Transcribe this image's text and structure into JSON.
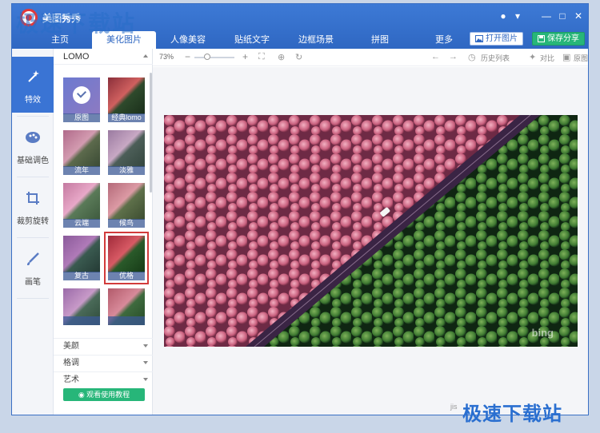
{
  "app": {
    "title": "美图秀秀"
  },
  "window_controls": {
    "chat": "●",
    "menu": "▾",
    "minimize": "—",
    "maximize": "□",
    "close": "✕"
  },
  "tabs": [
    {
      "label": "主页"
    },
    {
      "label": "美化图片"
    },
    {
      "label": "人像美容"
    },
    {
      "label": "贴纸文字"
    },
    {
      "label": "边框场景"
    },
    {
      "label": "拼图"
    },
    {
      "label": "更多"
    }
  ],
  "header_buttons": {
    "open": "打开图片",
    "save": "保存分享"
  },
  "rail": [
    {
      "label": "特效",
      "icon": "magic-wand-icon"
    },
    {
      "label": "基础调色",
      "icon": "palette-icon"
    },
    {
      "label": "裁剪旋转",
      "icon": "crop-icon"
    },
    {
      "label": "画笔",
      "icon": "brush-icon"
    }
  ],
  "panel": {
    "category": "LOMO",
    "filters": [
      {
        "label": "原图"
      },
      {
        "label": "经典lomo"
      },
      {
        "label": "流年"
      },
      {
        "label": "淡雅"
      },
      {
        "label": "云端"
      },
      {
        "label": "候鸟"
      },
      {
        "label": "复古"
      },
      {
        "label": "优格"
      },
      {
        "label": ""
      },
      {
        "label": ""
      }
    ],
    "categories": [
      "美颜",
      "格调",
      "艺术"
    ],
    "tutorial": "观看使用教程"
  },
  "toolbar": {
    "zoom": "73%",
    "history": "历史列表",
    "compare": "对比",
    "original": "原图"
  },
  "photo": {
    "watermark": "bing"
  },
  "watermark": {
    "top": "极速下载站",
    "bottom": "极速下载站",
    "site": "jis"
  },
  "colors": {
    "accent": "#2f67c2",
    "save": "#27b679",
    "highlight": "#d23b3b"
  }
}
